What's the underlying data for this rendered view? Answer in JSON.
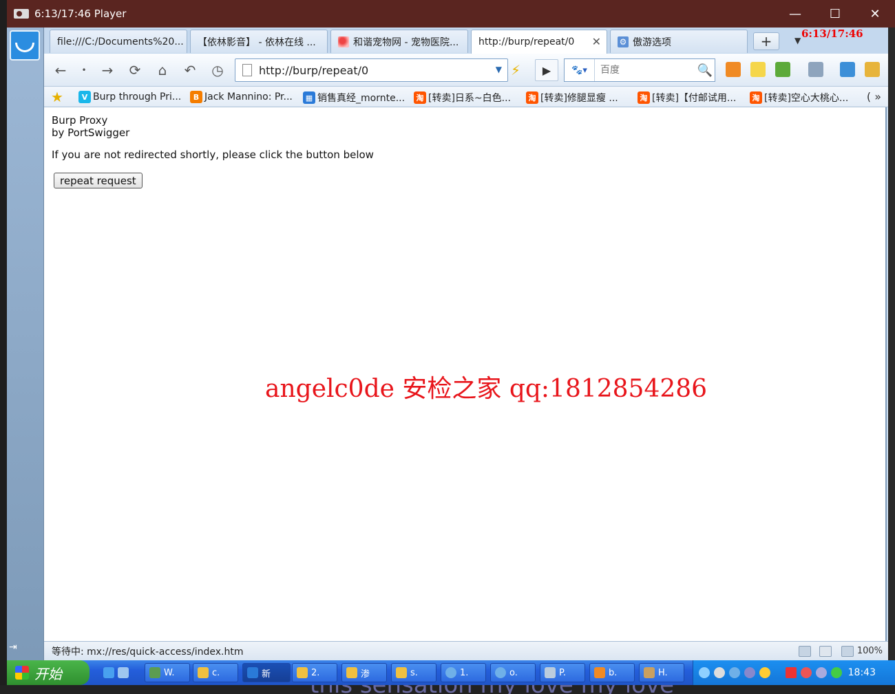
{
  "window": {
    "title": "6:13/17:46 Player",
    "minimize": "—",
    "maximize": "☐",
    "close": "✕"
  },
  "overlay_time": "6:13/17:46",
  "tabs": [
    {
      "label": "file:///C:/Documents%20...",
      "icon": "file-icon"
    },
    {
      "label": "【依林影音】 - 依林在线 ...",
      "icon": "none"
    },
    {
      "label": "和谐宠物网 - 宠物医院...",
      "icon": "paw-icon"
    },
    {
      "label": "http://burp/repeat/0",
      "icon": "none",
      "active": true
    },
    {
      "label": "傲游选项",
      "icon": "gear-icon"
    }
  ],
  "new_tab_label": "+",
  "nav": {
    "url": "http://burp/repeat/0",
    "search_placeholder": "百度"
  },
  "bookmarks": [
    {
      "label": "Burp through Pri...",
      "icon": "V",
      "color": "#1ab7ea"
    },
    {
      "label": "Jack Mannino: Pr...",
      "icon": "B",
      "color": "#f57d00"
    },
    {
      "label": "销售真经_mornte...",
      "icon": "▦",
      "color": "#2a7ad8"
    },
    {
      "label": "[转卖]日系~白色...",
      "icon": "淘",
      "color": "#ff5500"
    },
    {
      "label": "[转卖]修腿显瘦 ...",
      "icon": "淘",
      "color": "#ff5500"
    },
    {
      "label": "[转卖]【付邮试用...",
      "icon": "淘",
      "color": "#ff5500"
    },
    {
      "label": "[转卖]空心大桃心...",
      "icon": "淘",
      "color": "#ff5500"
    }
  ],
  "bookmarks_more": "( »",
  "page": {
    "line1": "Burp Proxy",
    "line2": "by PortSwigger",
    "message": "If you are not redirected shortly, please click the button below",
    "button": "repeat request"
  },
  "watermark": "angelc0de 安检之家 qq:1812854286",
  "status": {
    "text": "等待中: mx://res/quick-access/index.htm",
    "zoom": "100%"
  },
  "taskbar": {
    "start": "开始",
    "items": [
      "W.",
      "c.",
      "新",
      "2.",
      "渗",
      "s.",
      "1.",
      "o.",
      "P.",
      "b.",
      "H."
    ],
    "clock": "18:43"
  },
  "bottom_text": "this sensation my love my love"
}
